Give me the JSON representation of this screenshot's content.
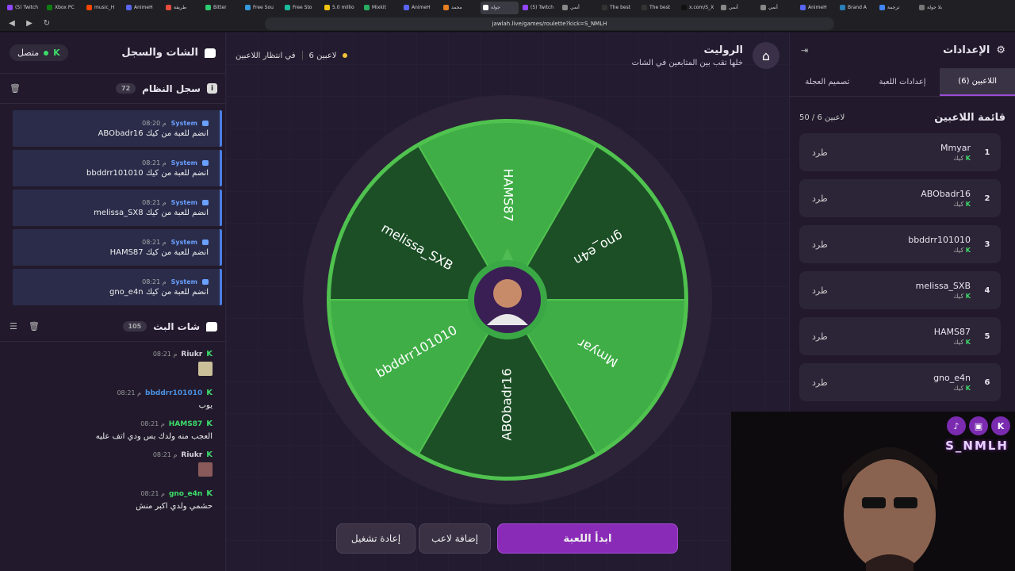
{
  "browser": {
    "url": "jawlah.live/games/roulette?kick=S_NMLH",
    "tabs": [
      "(5) Twitch",
      "Xbox PC",
      "music_H",
      "AnimeH",
      "طريقة",
      "Bitter",
      "Free Sou",
      "Free Sto",
      "5.0 millio",
      "Mixkit",
      "AnimeH",
      "محمد",
      "جولة",
      "(5) Twitch",
      "أنمي",
      "The best",
      "The best",
      "x.com/S_X",
      "أنمي",
      "أنمي",
      "AnimeH",
      "Brand A",
      "ترجمة",
      "بلا جولة"
    ]
  },
  "left": {
    "title": "الشات والسجل",
    "status": "متصل",
    "kick_glyph": "K",
    "syslog": {
      "title": "سجل النظام",
      "count": "72",
      "messages": [
        {
          "who": "System",
          "time": "08:20 م",
          "text": "ABObadr16 انضم للعبة من كيك"
        },
        {
          "who": "System",
          "time": "08:21 م",
          "text": "bbddrr101010 انضم للعبة من كيك"
        },
        {
          "who": "System",
          "time": "08:21 م",
          "text": "melissa_SX8 انضم للعبة من كيك"
        },
        {
          "who": "System",
          "time": "08:21 م",
          "text": "HAMS87 انضم للعبة من كيك"
        },
        {
          "who": "System",
          "time": "08:21 م",
          "text": "gno_e4n انضم للعبة من كيك"
        }
      ]
    },
    "chat": {
      "title": "شات البث",
      "count": "105",
      "messages": [
        {
          "user": "Riukr",
          "color": "#d7d2dc",
          "time": "08:21 م",
          "text": "",
          "emote": true
        },
        {
          "user": "bbddrr101010",
          "color": "#4a90e2",
          "time": "08:21 م",
          "text": "يوب",
          "emote": false
        },
        {
          "user": "HAMS87",
          "color": "#3ddc6a",
          "time": "08:21 م",
          "text": "العجب منه ولدك بس ودي اتف عليه",
          "emote": false
        },
        {
          "user": "Riukr",
          "color": "#d7d2dc",
          "time": "08:21 م",
          "text": "",
          "emote": true
        },
        {
          "user": "gno_e4n",
          "color": "#3ddc6a",
          "time": "08:21 م",
          "text": "حشمي ولدي اكبر منش",
          "emote": false
        }
      ]
    }
  },
  "main": {
    "title": "الروليت",
    "subtitle": "خلها تقب بين المتابعين في الشات",
    "players_count": "6 لاعبين",
    "waiting": "في انتظار اللاعبين",
    "wheel_segments": [
      "HAMS87",
      "gno_e4n",
      "Mmyar",
      "ABObadr16",
      "bbddrr101010",
      "melissa_SXB"
    ],
    "wheel_colors": [
      "#3fae46",
      "#1c4f26",
      "#3fae46",
      "#1c4f26",
      "#3fae46",
      "#1c4f26"
    ],
    "buttons": {
      "start": "ابدأ اللعبة",
      "add": "إضافة لاعب",
      "restart": "إعادة تشغيل"
    }
  },
  "right": {
    "title": "الإعدادات",
    "tabs": [
      "اللاعبين (6)",
      "إعدادات اللعبة",
      "تصميم العجلة"
    ],
    "list_title": "قائمة اللاعبين",
    "list_count": "50 / 6 لاعبين",
    "kick_label": "طرد",
    "source_label": "كيك",
    "players": [
      {
        "num": "1",
        "name": "Mmyar"
      },
      {
        "num": "2",
        "name": "ABObadr16"
      },
      {
        "num": "3",
        "name": "bbddrr101010"
      },
      {
        "num": "4",
        "name": "melissa_SXB"
      },
      {
        "num": "5",
        "name": "HAMS87"
      },
      {
        "num": "6",
        "name": "gno_e4n"
      }
    ]
  },
  "webcam": {
    "name": "S_NMLH",
    "socials": [
      "tiktok",
      "twitch",
      "kick"
    ]
  }
}
